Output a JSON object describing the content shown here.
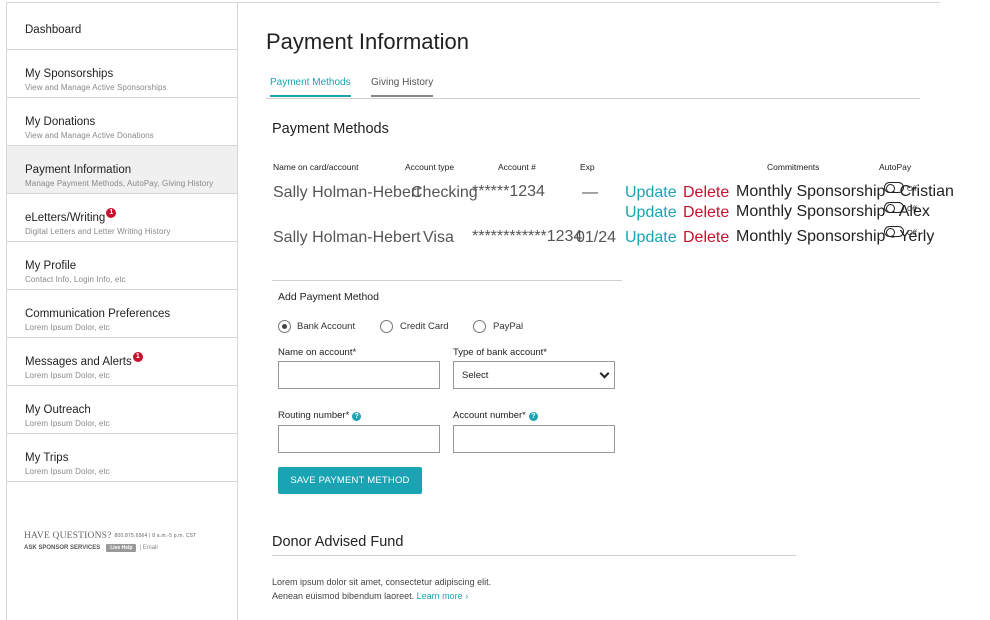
{
  "sidebar": {
    "items": [
      {
        "label": "Dashboard",
        "sub": ""
      },
      {
        "label": "My Sponsorships",
        "sub": "View and Manage Active Sponsorships"
      },
      {
        "label": "My Donations",
        "sub": "View and Manage Active Donations"
      },
      {
        "label": "Payment Information",
        "sub": "Manage Payment Methods, AutoPay, Giving History"
      },
      {
        "label": "eLetters/Writing",
        "sub": "Digital Letters and Letter Writing History",
        "badge": "1"
      },
      {
        "label": "My Profile",
        "sub": "Contact Info, Login Info, etc"
      },
      {
        "label": "Communication Preferences",
        "sub": "Lorem Ipsum Dolor, etc"
      },
      {
        "label": "Messages and Alerts",
        "sub": "Lorem Ipsum Dolor, etc",
        "badge": "1"
      },
      {
        "label": "My Outreach",
        "sub": "Lorem Ipsum Dolor, etc"
      },
      {
        "label": "My Trips",
        "sub": "Lorem Ipsum Dolor, etc"
      }
    ],
    "help": {
      "question": "HAVE QUESTIONS?",
      "hours": "800.875.6564 | 8 a.m.-5 p.m. CST",
      "ask": "ASK SPONSOR SERVICES",
      "live_help": "Live Help",
      "email": "| Email"
    }
  },
  "page": {
    "title": "Payment Information",
    "tabs": [
      "Payment Methods",
      "Giving  History"
    ]
  },
  "payment_methods": {
    "heading": "Payment Methods",
    "columns": [
      "Name on card/account",
      "Account type",
      "Account #",
      "Exp",
      "Commitments",
      "AutoPay"
    ],
    "rows": [
      {
        "name": "Sally Holman-Hebert",
        "type": "Checking",
        "account": "******1234",
        "exp": "—",
        "update": "Update",
        "delete": "Delete",
        "commitment": "Monthly Sponsorship - Cristian",
        "autopay": "Off"
      },
      {
        "name": "",
        "type": "",
        "account": "",
        "exp": "",
        "update": "Update",
        "delete": "Delete",
        "commitment": "Monthly Sponsorship - Alex",
        "autopay": "Off"
      },
      {
        "name": "Sally Holman-Hebert",
        "type": "Visa",
        "account": "************1234",
        "exp": "01/24",
        "update": "Update",
        "delete": "Delete",
        "commitment": "Monthly Sponsorship - Yerly",
        "autopay": "Off"
      }
    ]
  },
  "add_form": {
    "title": "Add Payment Method",
    "radios": [
      "Bank Account",
      "Credit Card",
      "PayPal"
    ],
    "selected_radio": "Bank Account",
    "name_label": "Name on account*",
    "type_label": "Type of bank account*",
    "type_value": "Select",
    "routing_label": "Routing number*",
    "account_label": "Account number*",
    "help_glyph": "?",
    "save_label": "SAVE PAYMENT METHOD"
  },
  "daf": {
    "heading": "Donor Advised Fund",
    "line1": "Lorem ipsum dolor sit amet, consectetur adipiscing elit.",
    "line2": "Aenean euismod bibendum laoreet.",
    "learn_more": "Learn more ›"
  },
  "colors": {
    "accent": "#1aa3b3",
    "danger": "#c8102e",
    "active_bg": "#f0f0f0"
  }
}
